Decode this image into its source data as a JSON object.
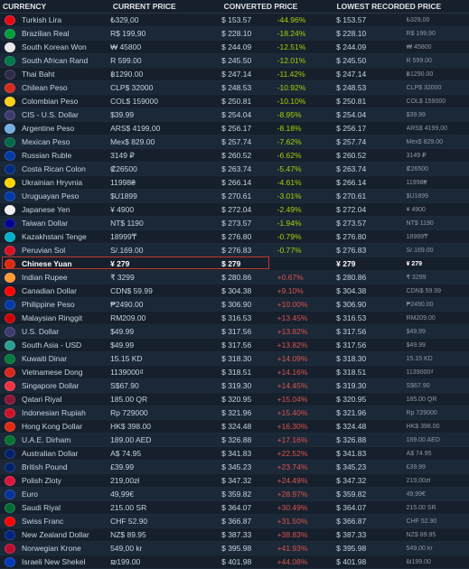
{
  "headers": {
    "currency": "CURRENCY",
    "current": "CURRENT PRICE",
    "converted": "CONVERTED PRICE",
    "lowest": "LOWEST RECORDED PRICE"
  },
  "highlight_color": "#c0392b",
  "rows": [
    {
      "currency": "Turkish Lira",
      "current": "₺329,00",
      "converted": "$ 153.57",
      "diff": "-44.96%",
      "lowest": "$ 153.57",
      "lowest_local": "₺329,00",
      "flag": "#e30a17",
      "sign": "neg"
    },
    {
      "currency": "Brazilian Real",
      "current": "R$ 199,90",
      "converted": "$ 228.10",
      "diff": "-18.24%",
      "lowest": "$ 228.10",
      "lowest_local": "R$ 199,90",
      "flag": "#009c3b",
      "sign": "neg"
    },
    {
      "currency": "South Korean Won",
      "current": "₩ 45800",
      "converted": "$ 244.09",
      "diff": "-12.51%",
      "lowest": "$ 244.09",
      "lowest_local": "₩ 45800",
      "flag": "#e8e8e8",
      "sign": "neg"
    },
    {
      "currency": "South African Rand",
      "current": "R 599.00",
      "converted": "$ 245.50",
      "diff": "-12.01%",
      "lowest": "$ 245.50",
      "lowest_local": "R 599.00",
      "flag": "#007749",
      "sign": "neg"
    },
    {
      "currency": "Thai Baht",
      "current": "฿1290.00",
      "converted": "$ 247.14",
      "diff": "-11.42%",
      "lowest": "$ 247.14",
      "lowest_local": "฿1290.00",
      "flag": "#2d2a4a",
      "sign": "neg"
    },
    {
      "currency": "Chilean Peso",
      "current": "CLP$ 32000",
      "converted": "$ 248.53",
      "diff": "-10.92%",
      "lowest": "$ 248.53",
      "lowest_local": "CLP$ 32000",
      "flag": "#d52b1e",
      "sign": "neg"
    },
    {
      "currency": "Colombian Peso",
      "current": "COL$ 159000",
      "converted": "$ 250.81",
      "diff": "-10.10%",
      "lowest": "$ 250.81",
      "lowest_local": "COL$ 159000",
      "flag": "#fcd116",
      "sign": "neg"
    },
    {
      "currency": "CIS - U.S. Dollar",
      "current": "$39.99",
      "converted": "$ 254.04",
      "diff": "-8.95%",
      "lowest": "$ 254.04",
      "lowest_local": "$39.99",
      "flag": "#3c3b6e",
      "sign": "neg"
    },
    {
      "currency": "Argentine Peso",
      "current": "ARS$ 4199,00",
      "converted": "$ 256.17",
      "diff": "-8.18%",
      "lowest": "$ 256.17",
      "lowest_local": "ARS$ 4199,00",
      "flag": "#74acdf",
      "sign": "neg"
    },
    {
      "currency": "Mexican Peso",
      "current": "Mex$ 829.00",
      "converted": "$ 257.74",
      "diff": "-7.62%",
      "lowest": "$ 257.74",
      "lowest_local": "Mex$ 829.00",
      "flag": "#006847",
      "sign": "neg"
    },
    {
      "currency": "Russian Ruble",
      "current": "3149 ₽",
      "converted": "$ 260.52",
      "diff": "-6.62%",
      "lowest": "$ 260.52",
      "lowest_local": "3149 ₽",
      "flag": "#0039a6",
      "sign": "neg"
    },
    {
      "currency": "Costa Rican Colon",
      "current": "₡26500",
      "converted": "$ 263.74",
      "diff": "-5.47%",
      "lowest": "$ 263.74",
      "lowest_local": "₡26500",
      "flag": "#002b7f",
      "sign": "neg"
    },
    {
      "currency": "Ukrainian Hryvnia",
      "current": "11998₴",
      "converted": "$ 266.14",
      "diff": "-4.61%",
      "lowest": "$ 266.14",
      "lowest_local": "11998₴",
      "flag": "#ffd500",
      "sign": "neg"
    },
    {
      "currency": "Uruguayan Peso",
      "current": "$U1899",
      "converted": "$ 270.61",
      "diff": "-3.01%",
      "lowest": "$ 270.61",
      "lowest_local": "$U1899",
      "flag": "#0038a8",
      "sign": "neg"
    },
    {
      "currency": "Japanese Yen",
      "current": "¥ 4900",
      "converted": "$ 272.04",
      "diff": "-2.49%",
      "lowest": "$ 272.04",
      "lowest_local": "¥ 4900",
      "flag": "#f0f0f0",
      "sign": "neg"
    },
    {
      "currency": "Taiwan Dollar",
      "current": "NT$ 1190",
      "converted": "$ 273.57",
      "diff": "-1.94%",
      "lowest": "$ 273.57",
      "lowest_local": "NT$ 1190",
      "flag": "#000095",
      "sign": "neg"
    },
    {
      "currency": "Kazakhstani Tenge",
      "current": "18999₸",
      "converted": "$ 276.80",
      "diff": "-0.79%",
      "lowest": "$ 276.80",
      "lowest_local": "18999₸",
      "flag": "#00afca",
      "sign": "neg"
    },
    {
      "currency": "Peruvian Sol",
      "current": "S/.169.00",
      "converted": "$ 276.83",
      "diff": "-0.77%",
      "lowest": "$ 276.83",
      "lowest_local": "S/.169.00",
      "flag": "#d91023",
      "sign": "neg"
    },
    {
      "currency": "Chinese Yuan",
      "current": "¥ 279",
      "converted": "$ 279",
      "diff": "",
      "lowest": "¥ 279",
      "lowest_local": "¥ 279",
      "flag": "#de2910",
      "sign": "",
      "highlight": true
    },
    {
      "currency": "Indian Rupee",
      "current": "₹ 3299",
      "converted": "$ 280.86",
      "diff": "+0.67%",
      "lowest": "$ 280.86",
      "lowest_local": "₹ 3299",
      "flag": "#ff9933",
      "sign": "pos"
    },
    {
      "currency": "Canadian Dollar",
      "current": "CDN$ 59.99",
      "converted": "$ 304.38",
      "diff": "+9.10%",
      "lowest": "$ 304.38",
      "lowest_local": "CDN$ 59.99",
      "flag": "#ff0000",
      "sign": "pos"
    },
    {
      "currency": "Philippine Peso",
      "current": "₱2490.00",
      "converted": "$ 306.90",
      "diff": "+10.00%",
      "lowest": "$ 306.90",
      "lowest_local": "₱2490.00",
      "flag": "#0038a8",
      "sign": "pos"
    },
    {
      "currency": "Malaysian Ringgit",
      "current": "RM209.00",
      "converted": "$ 316.53",
      "diff": "+13.45%",
      "lowest": "$ 316.53",
      "lowest_local": "RM209.00",
      "flag": "#cc0001",
      "sign": "pos"
    },
    {
      "currency": "U.S. Dollar",
      "current": "$49.99",
      "converted": "$ 317.56",
      "diff": "+13.82%",
      "lowest": "$ 317.56",
      "lowest_local": "$49.99",
      "flag": "#3c3b6e",
      "sign": "pos"
    },
    {
      "currency": "South Asia - USD",
      "current": "$49.99",
      "converted": "$ 317.56",
      "diff": "+13.82%",
      "lowest": "$ 317.56",
      "lowest_local": "$49.99",
      "flag": "#2a9d8f",
      "sign": "pos"
    },
    {
      "currency": "Kuwaiti Dinar",
      "current": "15.15 KD",
      "converted": "$ 318.30",
      "diff": "+14.09%",
      "lowest": "$ 318.30",
      "lowest_local": "15.15 KD",
      "flag": "#007a3d",
      "sign": "pos"
    },
    {
      "currency": "Vietnamese Dong",
      "current": "1139000₫",
      "converted": "$ 318.51",
      "diff": "+14.16%",
      "lowest": "$ 318.51",
      "lowest_local": "1139000₫",
      "flag": "#da251d",
      "sign": "pos"
    },
    {
      "currency": "Singapore Dollar",
      "current": "S$67.90",
      "converted": "$ 319.30",
      "diff": "+14.45%",
      "lowest": "$ 319.30",
      "lowest_local": "S$67.90",
      "flag": "#ef3340",
      "sign": "pos"
    },
    {
      "currency": "Qatari Riyal",
      "current": "185.00 QR",
      "converted": "$ 320.95",
      "diff": "+15.04%",
      "lowest": "$ 320.95",
      "lowest_local": "185.00 QR",
      "flag": "#8a1538",
      "sign": "pos"
    },
    {
      "currency": "Indonesian Rupiah",
      "current": "Rp 729000",
      "converted": "$ 321.96",
      "diff": "+15.40%",
      "lowest": "$ 321.96",
      "lowest_local": "Rp 729000",
      "flag": "#ce1126",
      "sign": "pos"
    },
    {
      "currency": "Hong Kong Dollar",
      "current": "HK$ 398.00",
      "converted": "$ 324.48",
      "diff": "+16.30%",
      "lowest": "$ 324.48",
      "lowest_local": "HK$ 398.00",
      "flag": "#de2910",
      "sign": "pos"
    },
    {
      "currency": "U.A.E. Dirham",
      "current": "189.00 AED",
      "converted": "$ 326.88",
      "diff": "+17.16%",
      "lowest": "$ 326.88",
      "lowest_local": "189.00 AED",
      "flag": "#00732f",
      "sign": "pos"
    },
    {
      "currency": "Australian Dollar",
      "current": "A$ 74.95",
      "converted": "$ 341.83",
      "diff": "+22.52%",
      "lowest": "$ 341.83",
      "lowest_local": "A$ 74.95",
      "flag": "#012169",
      "sign": "pos"
    },
    {
      "currency": "British Pound",
      "current": "£39.99",
      "converted": "$ 345.23",
      "diff": "+23.74%",
      "lowest": "$ 345.23",
      "lowest_local": "£39.99",
      "flag": "#012169",
      "sign": "pos"
    },
    {
      "currency": "Polish Zloty",
      "current": "219,00zł",
      "converted": "$ 347.32",
      "diff": "+24.49%",
      "lowest": "$ 347.32",
      "lowest_local": "219,00zł",
      "flag": "#dc143c",
      "sign": "pos"
    },
    {
      "currency": "Euro",
      "current": "49,99€",
      "converted": "$ 359.82",
      "diff": "+28.97%",
      "lowest": "$ 359.82",
      "lowest_local": "49,99€",
      "flag": "#003399",
      "sign": "pos"
    },
    {
      "currency": "Saudi Riyal",
      "current": "215.00 SR",
      "converted": "$ 364.07",
      "diff": "+30.49%",
      "lowest": "$ 364.07",
      "lowest_local": "215.00 SR",
      "flag": "#006c35",
      "sign": "pos"
    },
    {
      "currency": "Swiss Franc",
      "current": "CHF 52.90",
      "converted": "$ 366.87",
      "diff": "+31.50%",
      "lowest": "$ 366.87",
      "lowest_local": "CHF 52.90",
      "flag": "#ff0000",
      "sign": "pos"
    },
    {
      "currency": "New Zealand Dollar",
      "current": "NZ$ 89.95",
      "converted": "$ 387.33",
      "diff": "+38.83%",
      "lowest": "$ 387.33",
      "lowest_local": "NZ$ 89.95",
      "flag": "#00247d",
      "sign": "pos"
    },
    {
      "currency": "Norwegian Krone",
      "current": "549,00 kr",
      "converted": "$ 395.98",
      "diff": "+41.93%",
      "lowest": "$ 395.98",
      "lowest_local": "549,00 kr",
      "flag": "#ba0c2f",
      "sign": "pos"
    },
    {
      "currency": "Israeli New Shekel",
      "current": "₪199.00",
      "converted": "$ 401.98",
      "diff": "+44.08%",
      "lowest": "$ 401.98",
      "lowest_local": "₪199.00",
      "flag": "#0038b8",
      "sign": "pos"
    }
  ]
}
